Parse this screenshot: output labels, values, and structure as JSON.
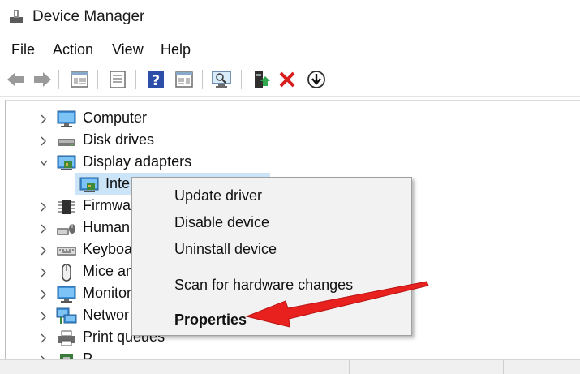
{
  "window": {
    "title": "Device Manager"
  },
  "menubar": {
    "items": [
      "File",
      "Action",
      "View",
      "Help"
    ]
  },
  "toolbar": {
    "icons": [
      "back-arrow-icon",
      "forward-arrow-icon",
      "show-hide-tree-icon",
      "properties-icon",
      "help-icon",
      "details-pane-icon",
      "scan-hardware-icon",
      "update-driver-icon",
      "uninstall-x-icon",
      "download-arrow-icon"
    ]
  },
  "tree": {
    "items": [
      {
        "label": "Computer",
        "icon": "computer-icon",
        "expanded": false
      },
      {
        "label": "Disk drives",
        "icon": "disk-drive-icon",
        "expanded": false
      },
      {
        "label": "Display adapters",
        "icon": "display-adapter-icon",
        "expanded": true
      },
      {
        "label": "Intel",
        "icon": "display-adapter-icon",
        "child": true,
        "selected": true
      },
      {
        "label": "Firmwar",
        "icon": "firmware-icon",
        "expanded": false
      },
      {
        "label": "Human",
        "icon": "hid-icon",
        "expanded": false
      },
      {
        "label": "Keyboar",
        "icon": "keyboard-icon",
        "expanded": false
      },
      {
        "label": "Mice an",
        "icon": "mouse-icon",
        "expanded": false
      },
      {
        "label": "Monitor",
        "icon": "monitor-icon",
        "expanded": false
      },
      {
        "label": "Networ",
        "icon": "network-icon",
        "expanded": false
      },
      {
        "label": "Print queues",
        "icon": "printer-icon",
        "expanded": false
      },
      {
        "label": "P",
        "icon": "processor-icon",
        "expanded": false
      }
    ]
  },
  "context_menu": {
    "items": [
      "Update driver",
      "Disable device",
      "Uninstall device",
      "Scan for hardware changes",
      "Properties"
    ]
  },
  "colors": {
    "accent_arrow": "#e8211f",
    "selection": "#cce4f7",
    "menu_bg": "#f2f2f2"
  }
}
